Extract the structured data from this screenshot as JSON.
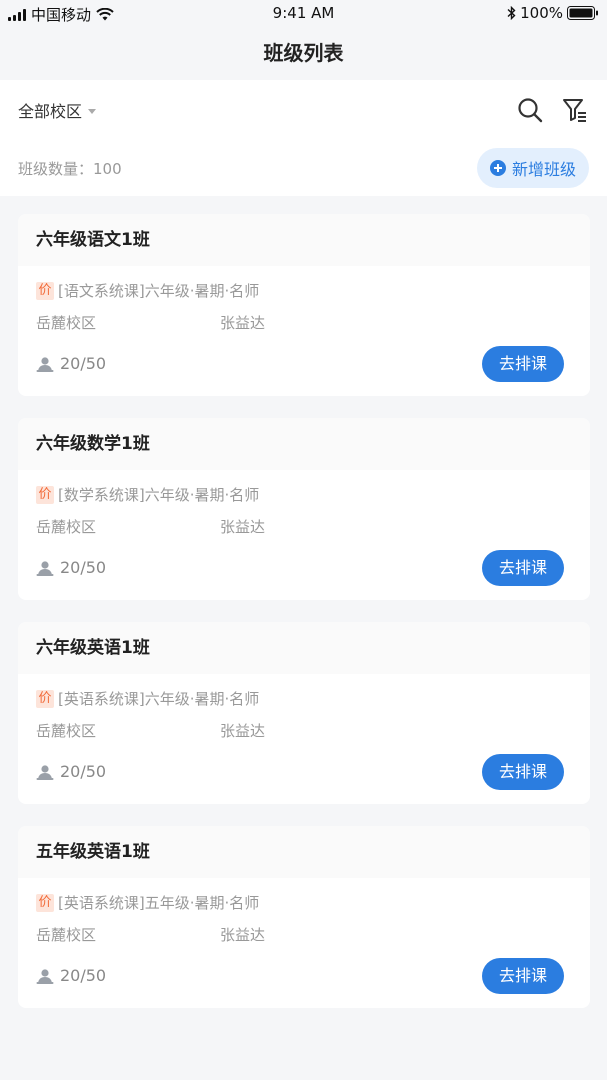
{
  "status_bar": {
    "carrier": "中国移动",
    "time": "9:41 AM",
    "battery": "100%"
  },
  "nav": {
    "title": "班级列表"
  },
  "filter": {
    "campus_selector": "全部校区",
    "class_count_label": "班级数量：100",
    "add_button_label": "新增班级"
  },
  "classes": [
    {
      "name": "六年级语文1班",
      "price_tag": "价",
      "course": "[语文系统课]六年级·暑期·名师",
      "campus": "岳麓校区",
      "teacher": "张益达",
      "enrollment": "20/50",
      "action": "去排课"
    },
    {
      "name": "六年级数学1班",
      "price_tag": "价",
      "course": "[数学系统课]六年级·暑期·名师",
      "campus": "岳麓校区",
      "teacher": "张益达",
      "enrollment": "20/50",
      "action": "去排课"
    },
    {
      "name": "六年级英语1班",
      "price_tag": "价",
      "course": "[英语系统课]六年级·暑期·名师",
      "campus": "岳麓校区",
      "teacher": "张益达",
      "enrollment": "20/50",
      "action": "去排课"
    },
    {
      "name": "五年级英语1班",
      "price_tag": "价",
      "course": "[英语系统课]五年级·暑期·名师",
      "campus": "岳麓校区",
      "teacher": "张益达",
      "enrollment": "20/50",
      "action": "去排课"
    }
  ],
  "colors": {
    "accent": "#2b7de0",
    "accent_light": "#e3effd",
    "price_tag": "#f26b3a"
  }
}
